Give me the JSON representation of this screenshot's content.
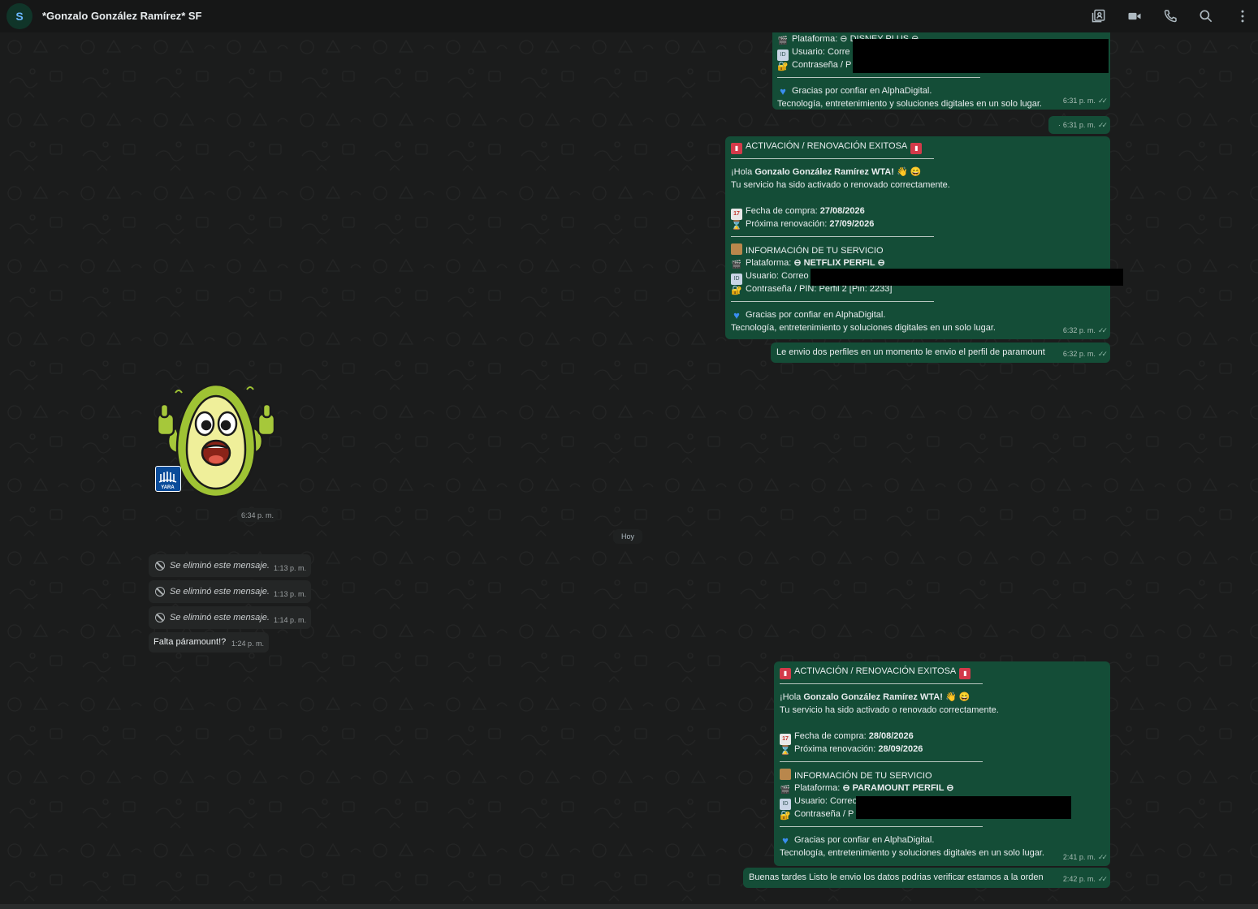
{
  "header": {
    "avatar_letter": "S",
    "title": "*Gonzalo González Ramírez* SF",
    "icons": [
      "contact-card-icon",
      "video-call-icon",
      "phone-icon",
      "search-icon",
      "more-options-icon"
    ]
  },
  "colors": {
    "outgoing_bubble": "#144d37",
    "incoming_bubble": "#242626",
    "chat_background": "#1b1c1c",
    "header_background": "#161717"
  },
  "messages": {
    "m1": {
      "lines": [
        "Plataforma: ⊖ DISNEY PLUS ⊖",
        "Usuario: Corre",
        "Contraseña / P"
      ],
      "thanks": "Gracias por confiar en AlphaDigital.",
      "tagline": "Tecnología, entretenimiento y soluciones digitales en un solo lugar.",
      "time": "6:31 p. m."
    },
    "m2": {
      "text": "·",
      "time": "6:31 p. m."
    },
    "m3": {
      "heading": "ACTIVACIÓN / RENOVACIÓN EXITOSA",
      "greet_pre": "¡Hola ",
      "greet_name": "Gonzalo González Ramírez WTA!",
      "status": "Tu servicio ha sido activado o renovado correctamente.",
      "purchase_label": "Fecha de compra: ",
      "purchase_date": "27/08/2026",
      "renewal_label": "Próxima renovación: ",
      "renewal_date": "27/09/2026",
      "info_heading": "INFORMACIÓN DE TU SERVICIO",
      "platform_label": "Plataforma: ",
      "platform_value": "⊖ NETFLIX PERFIL ⊖",
      "user_label": "Usuario: Correo",
      "password_label": "Contraseña / PIN: Perfil 2 [Pin: 2233]",
      "thanks": "Gracias por confiar en AlphaDigital.",
      "tagline": "Tecnología, entretenimiento y soluciones digitales en un solo lugar.",
      "time": "6:32 p. m."
    },
    "m4": {
      "text": "Le envio dos perfiles en un momento le envio el perfil de paramount",
      "time": "6:32 p. m."
    },
    "sticker": {
      "badge": "YARA",
      "time": "6:34 p. m."
    },
    "date_divider": "Hoy",
    "deleted": [
      {
        "text": "Se eliminó este mensaje.",
        "time": "1:13 p. m."
      },
      {
        "text": "Se eliminó este mensaje.",
        "time": "1:13 p. m."
      },
      {
        "text": "Se eliminó este mensaje.",
        "time": "1:14 p. m."
      }
    ],
    "m5": {
      "text": "Falta páramount!?",
      "time": "1:24 p. m."
    },
    "m6": {
      "heading": "ACTIVACIÓN / RENOVACIÓN EXITOSA",
      "greet_pre": "¡Hola ",
      "greet_name": "Gonzalo González Ramírez WTA!",
      "status": "Tu servicio ha sido activado o renovado correctamente.",
      "purchase_label": "Fecha de compra: ",
      "purchase_date": "28/08/2026",
      "renewal_label": "Próxima renovación: ",
      "renewal_date": "28/09/2026",
      "info_heading": "INFORMACIÓN DE TU SERVICIO",
      "platform_label": "Plataforma: ",
      "platform_value": "⊖ PARAMOUNT PERFIL ⊖",
      "user_label": "Usuario: Correo",
      "password_label": "Contraseña / P",
      "thanks": "Gracias por confiar en AlphaDigital.",
      "tagline": "Tecnología, entretenimiento y soluciones digitales en un solo lugar.",
      "time": "2:41 p. m."
    },
    "m7": {
      "text": "Buenas tardes Listo le envio los datos podrias verificar estamos a la orden",
      "time": "2:42 p. m."
    }
  }
}
